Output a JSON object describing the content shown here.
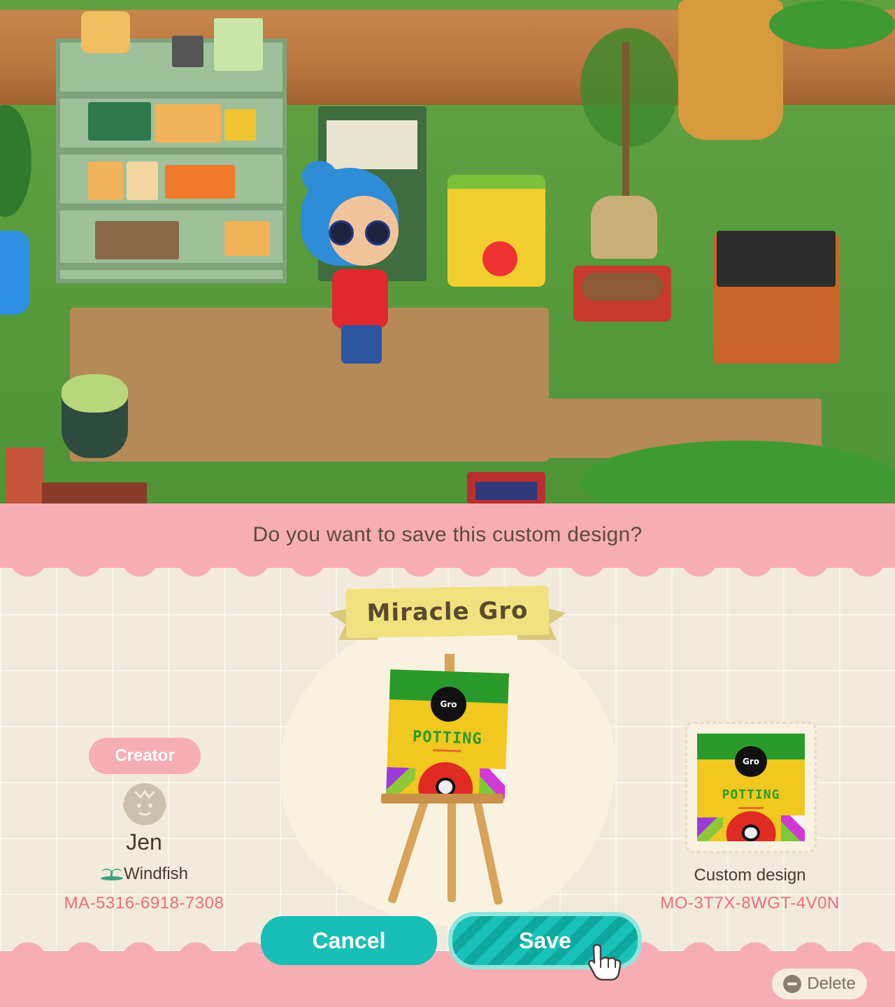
{
  "dialog": {
    "question": "Do you want to save this custom design?",
    "design_title": "Miracle Gro"
  },
  "creator": {
    "label": "Creator",
    "name": "Jen",
    "island": "Windfish",
    "code": "MA-5316-6918-7308"
  },
  "design": {
    "type_label": "Custom design",
    "code": "MO-3T7X-8WGT-4V0N",
    "art_logo_text": "Gro",
    "art_text": "POTTING"
  },
  "buttons": {
    "cancel": "Cancel",
    "save": "Save",
    "delete": "Delete"
  },
  "colors": {
    "pink": "#f6aeb4",
    "teal": "#17bfb6",
    "cream": "#f2eadc",
    "banner": "#f2e27f",
    "code_pink": "#e8707a"
  },
  "icons": [
    "person-face-icon",
    "island-palm-icon",
    "hand-pointer-icon",
    "minus-circle-icon"
  ]
}
